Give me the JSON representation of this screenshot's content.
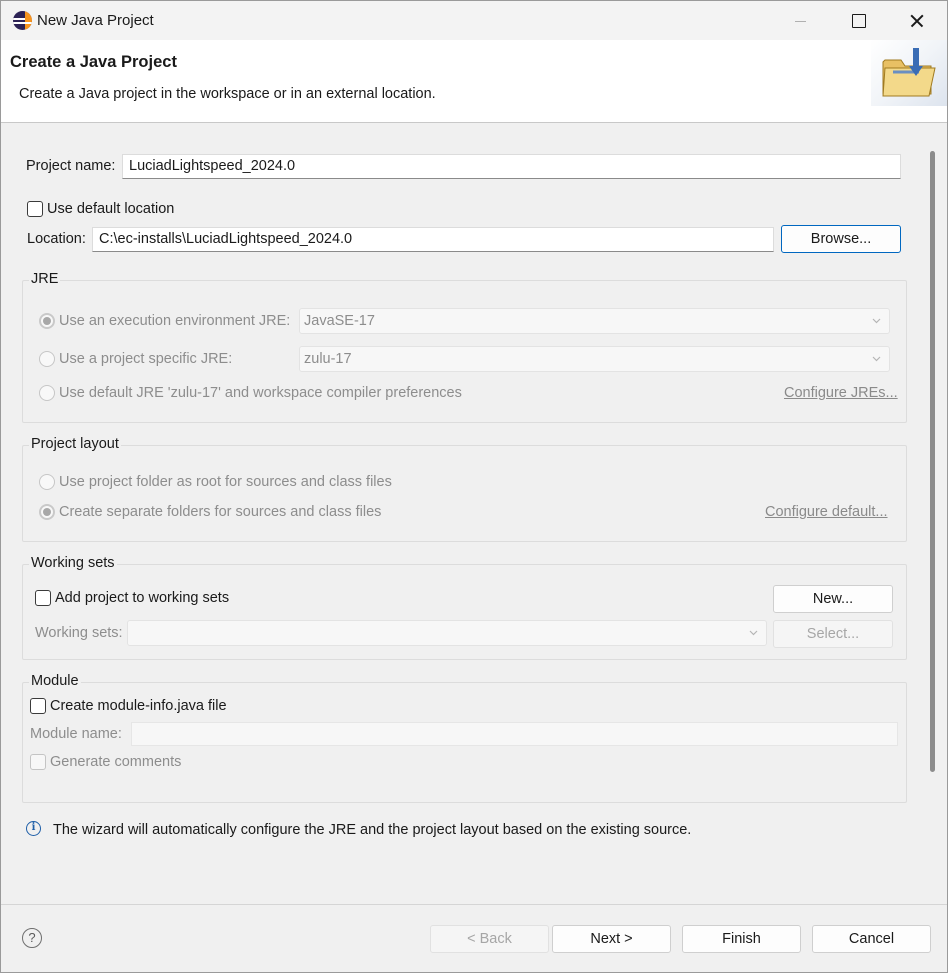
{
  "window": {
    "title": "New Java Project"
  },
  "banner": {
    "title": "Create a Java Project",
    "description": "Create a Java project in the workspace or in an external location."
  },
  "project": {
    "name_label": "Project name:",
    "name_value": "LuciadLightspeed_2024.0",
    "use_default_location_label": "Use default location",
    "use_default_location_checked": false,
    "location_label": "Location:",
    "location_value": "C:\\ec-installs\\LuciadLightspeed_2024.0",
    "browse_label": "Browse..."
  },
  "jre": {
    "group_label": "JRE",
    "exec_env_label": "Use an execution environment JRE:",
    "exec_env_value": "JavaSE-17",
    "specific_label": "Use a project specific JRE:",
    "specific_value": "zulu-17",
    "default_label": "Use default JRE 'zulu-17' and workspace compiler preferences",
    "configure_link": "Configure JREs..."
  },
  "layout": {
    "group_label": "Project layout",
    "root_label": "Use project folder as root for sources and class files",
    "separate_label": "Create separate folders for sources and class files",
    "configure_link": "Configure default..."
  },
  "working_sets": {
    "group_label": "Working sets",
    "add_label": "Add project to working sets",
    "new_label": "New...",
    "sets_label": "Working sets:",
    "select_label": "Select..."
  },
  "module": {
    "group_label": "Module",
    "create_label": "Create module-info.java file",
    "name_label": "Module name:",
    "comments_label": "Generate comments"
  },
  "info": {
    "icon": "info-icon",
    "message": "The wizard will automatically configure the JRE and the project layout based on the existing source."
  },
  "footer": {
    "back_label": "< Back",
    "next_label": "Next >",
    "finish_label": "Finish",
    "cancel_label": "Cancel"
  }
}
